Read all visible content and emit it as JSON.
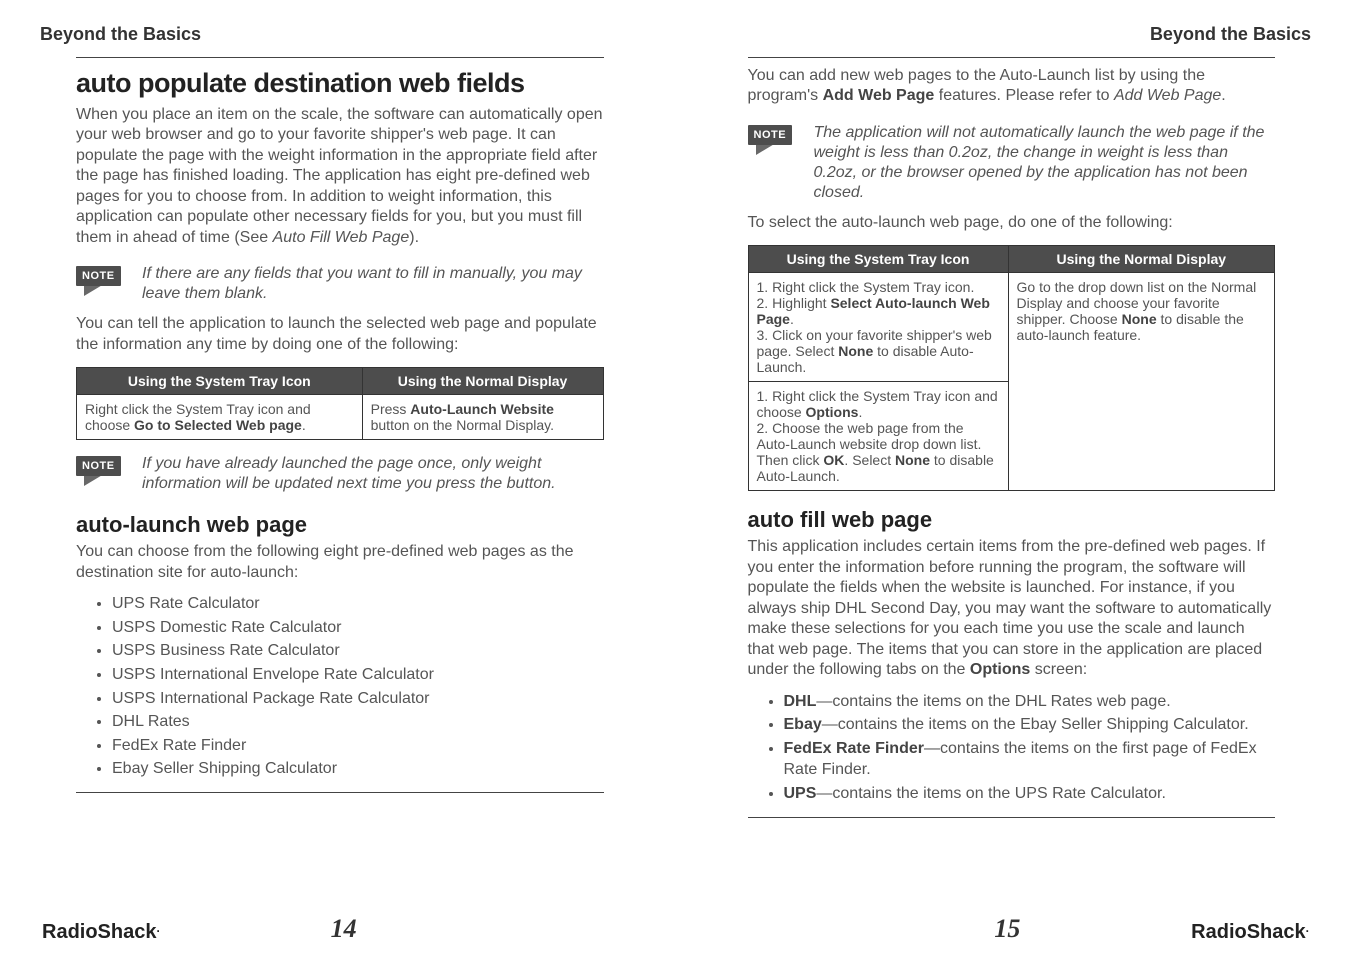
{
  "running_heads": {
    "left": "Beyond the Basics",
    "right": "Beyond the Basics"
  },
  "brand": "RadioShack",
  "page_numbers": {
    "left": "14",
    "right": "15"
  },
  "left": {
    "h1": "auto populate destination web fields",
    "p1": "When you place an item on the scale, the software can automatically open your web browser and go to your favorite shipper's web page. It can populate the page with the weight information in the appropriate field after the page has finished loading. The application has eight pre-defined web pages for you to choose from. In addition to weight information, this application can populate other necessary fields for you, but you must fill them in ahead of time (See ",
    "p1_ital": "Auto Fill Web Page",
    "p1_end": ").",
    "note1": "If there are any fields that you want to fill in manually, you may leave them blank.",
    "p2": "You can tell the application to launch the selected web page and populate the information any time by doing one of the following:",
    "table1": {
      "h1": "Using the System Tray Icon",
      "h2": "Using the Normal Display",
      "c1a": "Right click the System Tray icon and choose ",
      "c1b": "Go to Selected Web page",
      "c1c": ".",
      "c2a": "Press ",
      "c2b": "Auto-Launch Website",
      "c2c": " button on the Normal Display."
    },
    "note2": "If you have already launched the page once, only weight information will be updated next time you press the button.",
    "h2": "auto-launch web page",
    "p3": "You can choose from the following eight pre-defined web pages as the destination site for auto-launch:",
    "list": [
      "UPS Rate Calculator",
      "USPS Domestic Rate Calculator",
      "USPS Business Rate Calculator",
      "USPS International Envelope Rate Calculator",
      "USPS International Package Rate Calculator",
      "DHL Rates",
      "FedEx Rate Finder",
      "Ebay Seller Shipping Calculator"
    ]
  },
  "right": {
    "p1a": "You can add new web pages to the Auto-Launch list by using the program's ",
    "p1b": "Add Web Page",
    "p1c": " features. Please refer to ",
    "p1_ital": "Add Web Page",
    "p1d": ".",
    "note": "The application will not automatically launch the web page if the weight is less than 0.2oz, the change in weight is less than 0.2oz, or the browser opened by the application has not been closed.",
    "p2": "To select the auto-launch web page, do one of the following:",
    "table": {
      "h1": "Using the System Tray Icon",
      "h2": "Using the Normal Display",
      "rowA": {
        "l1": "1. Right click the System Tray icon.",
        "l2a": "2. Highlight ",
        "l2b": "Select Auto-launch Web Page",
        "l2c": ".",
        "l3a": "3. Click on your favorite shipper's web page. Select ",
        "l3b": "None",
        "l3c": " to disable Auto-Launch."
      },
      "rowB": {
        "l1a": "1. Right click the System Tray icon and choose ",
        "l1b": "Options",
        "l1c": ".",
        "l2a": "2. Choose the web page from the Auto-Launch website drop down list. Then click ",
        "l2b": "OK",
        "l2c": ". Select ",
        "l2d": "None",
        "l2e": " to disable Auto-Launch."
      },
      "rhsA": "Go to the drop down list on the Normal Display and choose your favorite shipper. Choose ",
      "rhsB": "None",
      "rhsC": " to disable the auto-launch feature."
    },
    "h2": "auto fill web page",
    "p3a": "This application includes certain items from the pre-defined web pages. If you enter the information before running the program, the software will populate the fields when the website is launched. For instance, if you always ship DHL Second Day, you may want the software to automatically make these selections for you each time you use the scale and launch that web page. The items that you can store in the application are placed under the following tabs on the ",
    "p3b": "Options",
    "p3c": " screen:",
    "list": [
      {
        "b": "DHL",
        "t": "—contains the items on the DHL Rates web page."
      },
      {
        "b": "Ebay",
        "t": "—contains the items on the Ebay Seller Shipping Calculator."
      },
      {
        "b": "FedEx Rate Finder",
        "t": "—contains the items on the first page of FedEx Rate Finder."
      },
      {
        "b": "UPS",
        "t": "—contains the items on the UPS Rate Calculator."
      }
    ]
  },
  "note_label": "NOTE"
}
